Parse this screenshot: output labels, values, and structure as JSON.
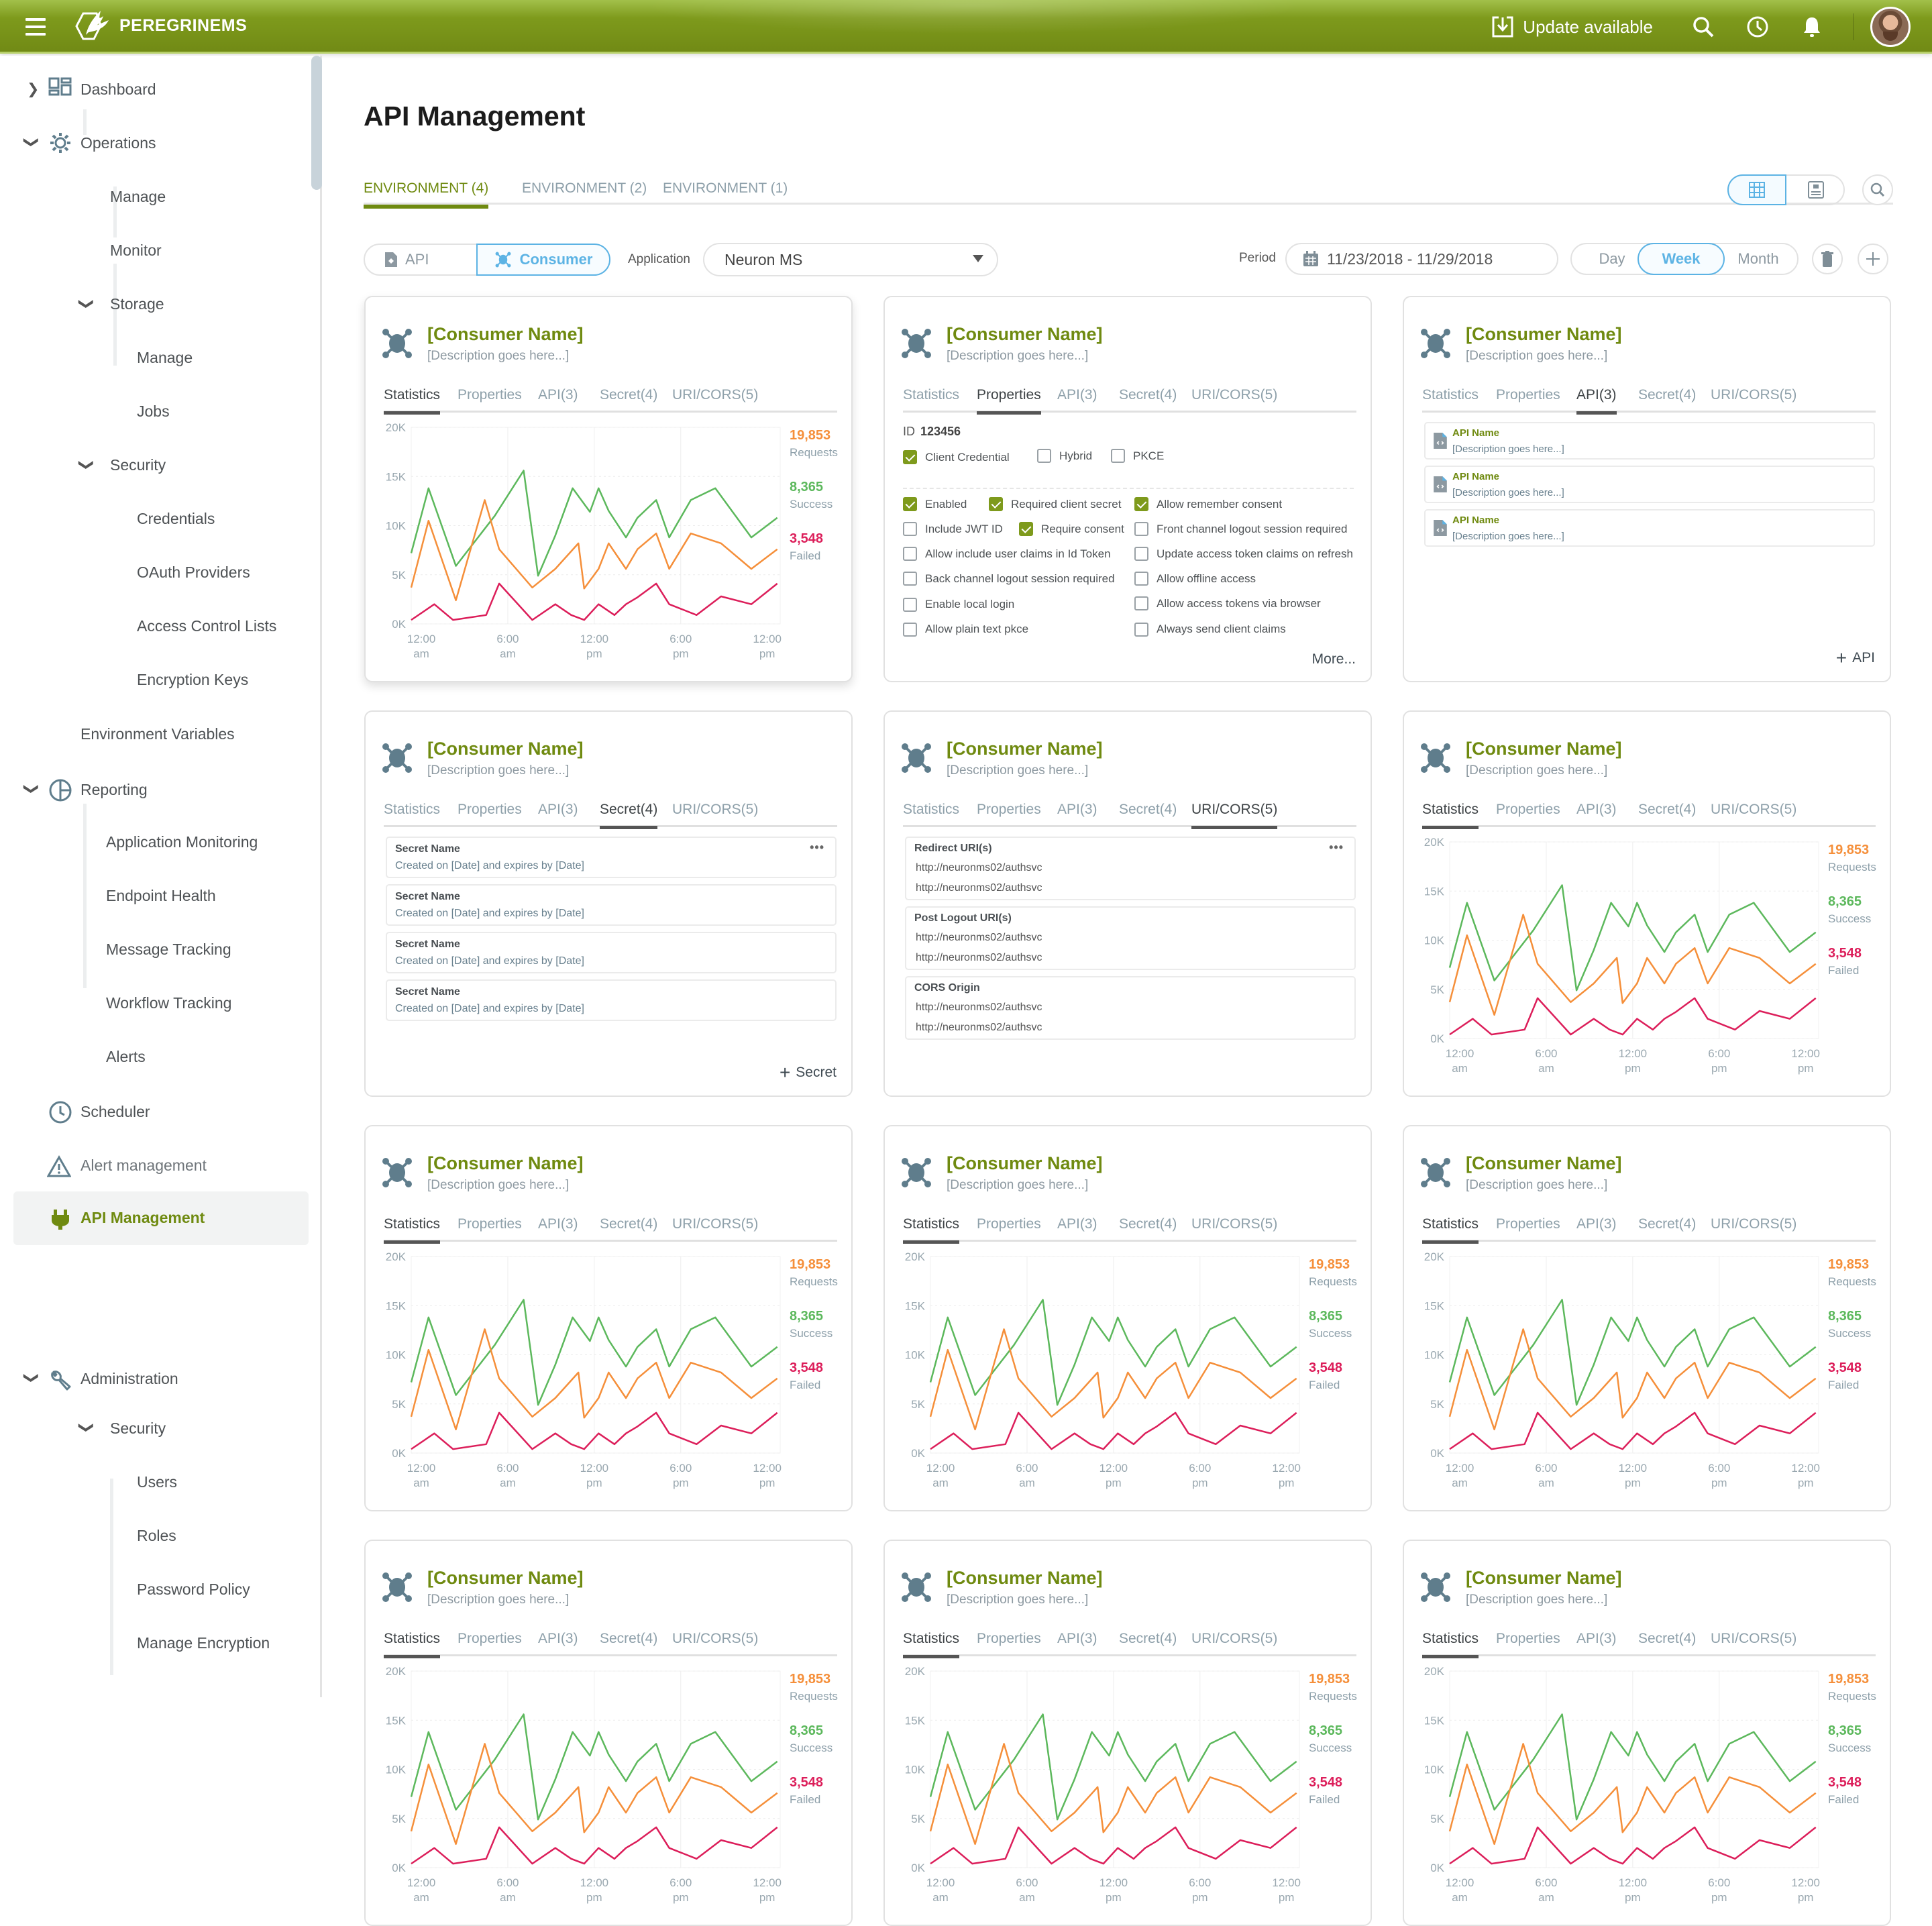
{
  "header": {
    "brand": "PEREGRINEMS",
    "update_label": "Update available",
    "icons": [
      "menu-icon",
      "logo-icon",
      "download-icon",
      "search-icon",
      "clock-icon",
      "bell-icon",
      "avatar"
    ],
    "colors": {
      "brand_green": "#718a15",
      "accent_blue": "#5cb3e4",
      "link_green": "#6f8a10"
    }
  },
  "sidebar": {
    "items": [
      {
        "label": "Dashboard",
        "icon": "dashboard-icon",
        "chevron": "right"
      },
      {
        "label": "Operations",
        "icon": "gear-icon",
        "chevron": "down"
      },
      {
        "label": "Manage"
      },
      {
        "label": "Monitor"
      },
      {
        "label": "Storage",
        "chevron": "down"
      },
      {
        "label": "Manage"
      },
      {
        "label": "Jobs"
      },
      {
        "label": "Security",
        "chevron": "down"
      },
      {
        "label": "Credentials"
      },
      {
        "label": "OAuth Providers"
      },
      {
        "label": "Access Control Lists"
      },
      {
        "label": "Encryption Keys"
      },
      {
        "label": "Environment Variables"
      },
      {
        "label": "Reporting",
        "icon": "pie-chart-icon",
        "chevron": "down"
      },
      {
        "label": "Application Monitoring"
      },
      {
        "label": "Endpoint Health"
      },
      {
        "label": "Message Tracking"
      },
      {
        "label": "Workflow Tracking"
      },
      {
        "label": "Alerts"
      },
      {
        "label": "Scheduler",
        "icon": "clock-icon"
      },
      {
        "label": "Alert management",
        "icon": "warning-icon"
      },
      {
        "label": "API Management",
        "icon": "plug-icon",
        "active": true
      },
      {
        "label": "Administration",
        "icon": "wrench-icon",
        "chevron": "down"
      },
      {
        "label": "Security",
        "chevron": "down"
      },
      {
        "label": "Users"
      },
      {
        "label": "Roles"
      },
      {
        "label": "Password Policy"
      },
      {
        "label": "Manage Encryption"
      }
    ]
  },
  "page": {
    "title": "API Management",
    "env_tabs": [
      {
        "label": "ENVIRONMENT (4)",
        "active": true
      },
      {
        "label": "ENVIRONMENT (2)"
      },
      {
        "label": "ENVIRONMENT (1)"
      }
    ],
    "view_modes": [
      "grid-view-icon",
      "card-view-icon"
    ],
    "type_toggle": {
      "api_label": "API",
      "consumer_label": "Consumer",
      "selected": "Consumer"
    },
    "application_label": "Application",
    "application_value": "Neuron MS",
    "period_label": "Period",
    "period_value": "11/23/2018 - 11/29/2018",
    "range_options": [
      "Day",
      "Week",
      "Month"
    ],
    "range_selected": "Week"
  },
  "card_common": {
    "name": "[Consumer Name]",
    "description": "[Description goes here...]",
    "tabs": [
      "Statistics",
      "Properties",
      "API(3)",
      "Secret(4)",
      "URI/CORS(5)"
    ]
  },
  "cards": [
    {
      "active_tab": "Statistics"
    },
    {
      "active_tab": "Properties"
    },
    {
      "active_tab": "API(3)"
    },
    {
      "active_tab": "Secret(4)"
    },
    {
      "active_tab": "URI/CORS(5)"
    },
    {
      "active_tab": "Statistics"
    },
    {
      "active_tab": "Statistics"
    },
    {
      "active_tab": "Statistics"
    },
    {
      "active_tab": "Statistics"
    },
    {
      "active_tab": "Statistics"
    },
    {
      "active_tab": "Statistics"
    },
    {
      "active_tab": "Statistics"
    }
  ],
  "properties": {
    "id_label": "ID",
    "id_value": "123456",
    "grant_types": [
      {
        "label": "Client Credential",
        "checked": true
      },
      {
        "label": "Hybrid",
        "checked": false
      },
      {
        "label": "PKCE",
        "checked": false
      }
    ],
    "options": [
      {
        "label": "Enabled",
        "checked": true
      },
      {
        "label": "Required client secret",
        "checked": true
      },
      {
        "label": "Allow remember consent",
        "checked": true
      },
      {
        "label": "Include JWT ID",
        "checked": false
      },
      {
        "label": "Require consent",
        "checked": true
      },
      {
        "label": "Front channel logout session required",
        "checked": false
      },
      {
        "label": "Allow include user claims in Id Token",
        "checked": false
      },
      {
        "label": "Update access token claims on refresh",
        "checked": false
      },
      {
        "label": "Back channel logout session required",
        "checked": false
      },
      {
        "label": "Allow offline access",
        "checked": false
      },
      {
        "label": "Enable local login",
        "checked": false
      },
      {
        "label": "Allow access tokens via browser",
        "checked": false
      },
      {
        "label": "Allow plain text pkce",
        "checked": false
      },
      {
        "label": "Always send client claims",
        "checked": false
      }
    ],
    "more_label": "More..."
  },
  "apis": {
    "items": [
      {
        "name": "API Name",
        "description": "[Description goes here...]"
      },
      {
        "name": "API Name",
        "description": "[Description goes here...]"
      },
      {
        "name": "API Name",
        "description": "[Description goes here...]"
      }
    ],
    "add_label": "API"
  },
  "secrets": {
    "items": [
      {
        "name": "Secret Name",
        "detail": "Created on [Date] and expires by [Date]"
      },
      {
        "name": "Secret Name",
        "detail": "Created on [Date] and expires by [Date]"
      },
      {
        "name": "Secret Name",
        "detail": "Created on [Date] and expires by [Date]"
      },
      {
        "name": "Secret Name",
        "detail": "Created on [Date] and expires by [Date]"
      }
    ],
    "add_label": "Secret"
  },
  "uris": {
    "groups": [
      {
        "title": "Redirect URI(s)",
        "values": [
          "http://neuronms02/authsvc",
          "http://neuronms02/authsvc"
        ]
      },
      {
        "title": "Post Logout URI(s)",
        "values": [
          "http://neuronms02/authsvc",
          "http://neuronms02/authsvc"
        ]
      },
      {
        "title": "CORS Origin",
        "values": [
          "http://neuronms02/authsvc",
          "http://neuronms02/authsvc"
        ]
      }
    ]
  },
  "chart_data": {
    "type": "line",
    "title": "",
    "xlabel": "",
    "ylabel": "",
    "x_unit": "hours",
    "xlim": [
      -0.7,
      24.9
    ],
    "ylim": [
      0,
      20000
    ],
    "yticks": [
      "0K",
      "5K",
      "10K",
      "15K",
      "20K"
    ],
    "ytick_values": [
      0,
      5000,
      10000,
      15000,
      20000
    ],
    "xticks": [
      {
        "value": 0,
        "line1": "12:00",
        "line2": "am"
      },
      {
        "value": 6,
        "line1": "6:00",
        "line2": "am"
      },
      {
        "value": 12,
        "line1": "12:00",
        "line2": "pm"
      },
      {
        "value": 18,
        "line1": "6:00",
        "line2": "pm"
      },
      {
        "value": 24,
        "line1": "12:00",
        "line2": "pm"
      }
    ],
    "grid": true,
    "legend_position": "right",
    "series": [
      {
        "name": "Success",
        "color": "#5cb85c",
        "x": [
          -0.7,
          0.5,
          2.4,
          5.1,
          7.1,
          8.1,
          9.3,
          10.5,
          11.7,
          12.3,
          13.0,
          14.2,
          15.0,
          16.3,
          17.2,
          18.7,
          20.4,
          22.9,
          24.7
        ],
        "y": [
          7200,
          13800,
          5900,
          11000,
          15600,
          4900,
          9000,
          13800,
          11400,
          13800,
          11500,
          8800,
          10800,
          12600,
          8800,
          12600,
          13800,
          8800,
          10800
        ]
      },
      {
        "name": "Requests",
        "color": "#f58f3a",
        "x": [
          -0.7,
          0.5,
          2.4,
          4.4,
          5.4,
          7.7,
          9.3,
          10.9,
          11.3,
          12.3,
          13.0,
          14.2,
          15.0,
          16.3,
          17.2,
          18.7,
          20.8,
          22.9,
          24.7
        ],
        "y": [
          3700,
          10500,
          2400,
          12600,
          7600,
          3700,
          5600,
          8200,
          3600,
          5600,
          8200,
          5600,
          7600,
          9200,
          5600,
          9200,
          8200,
          5600,
          7600
        ]
      },
      {
        "name": "Failed",
        "color": "#dc1e5a",
        "x": [
          -0.7,
          0.9,
          2.2,
          4.5,
          5.4,
          7.7,
          9.3,
          10.4,
          11.3,
          12.3,
          13.4,
          14.2,
          15.0,
          16.3,
          17.2,
          19.1,
          20.8,
          22.9,
          24.7
        ],
        "y": [
          400,
          2000,
          400,
          900,
          4100,
          400,
          2000,
          900,
          400,
          2000,
          900,
          2000,
          2700,
          4100,
          2000,
          900,
          2800,
          2000,
          4100
        ]
      }
    ],
    "totals": [
      {
        "value": "19,853",
        "label": "Requests",
        "color": "#f58f3a"
      },
      {
        "value": "8,365",
        "label": "Success",
        "color": "#5cb85c"
      },
      {
        "value": "3,548",
        "label": "Failed",
        "color": "#dc1e5a"
      }
    ]
  }
}
